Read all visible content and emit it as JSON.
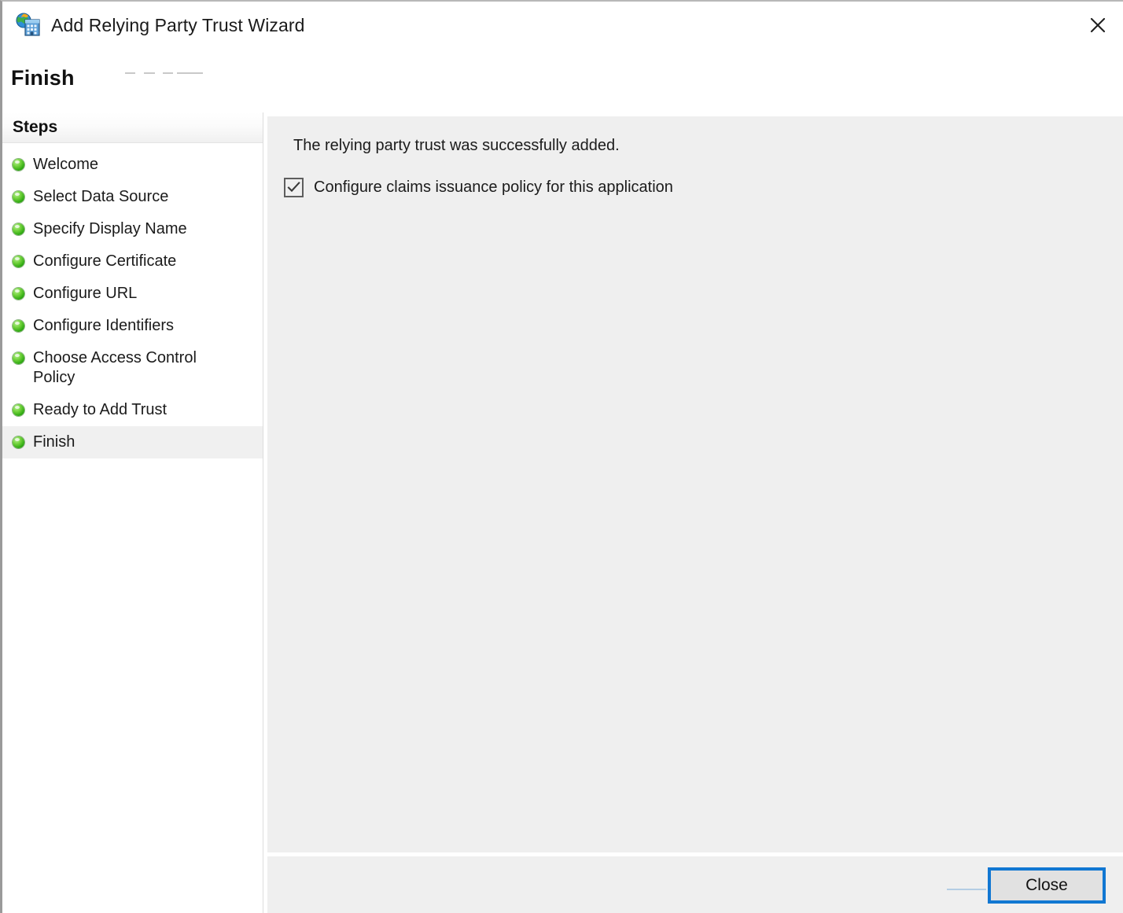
{
  "window": {
    "title": "Add Relying Party Trust Wizard",
    "icon": "relying-party-trust-icon",
    "close_icon": "close-icon"
  },
  "header": {
    "page_title": "Finish"
  },
  "sidebar": {
    "header_label": "Steps",
    "items": [
      {
        "label": "Welcome",
        "state": "completed",
        "current": false
      },
      {
        "label": "Select Data Source",
        "state": "completed",
        "current": false
      },
      {
        "label": "Specify Display Name",
        "state": "completed",
        "current": false
      },
      {
        "label": "Configure Certificate",
        "state": "completed",
        "current": false
      },
      {
        "label": "Configure URL",
        "state": "completed",
        "current": false
      },
      {
        "label": "Configure Identifiers",
        "state": "completed",
        "current": false
      },
      {
        "label": "Choose Access Control Policy",
        "state": "completed",
        "current": false
      },
      {
        "label": "Ready to Add Trust",
        "state": "completed",
        "current": false
      },
      {
        "label": "Finish",
        "state": "completed",
        "current": true
      }
    ]
  },
  "content": {
    "success_message": "The relying party trust was successfully added.",
    "checkbox": {
      "label": "Configure claims issuance policy for this application",
      "checked": true,
      "icon": "checkmark-icon"
    }
  },
  "footer": {
    "close_label": "Close"
  },
  "colors": {
    "accent_focus": "#1177d2",
    "panel_background": "#efefef",
    "sidebar_background": "#ffffff",
    "step_complete": "#2da811",
    "text": "#1b1b1b"
  }
}
